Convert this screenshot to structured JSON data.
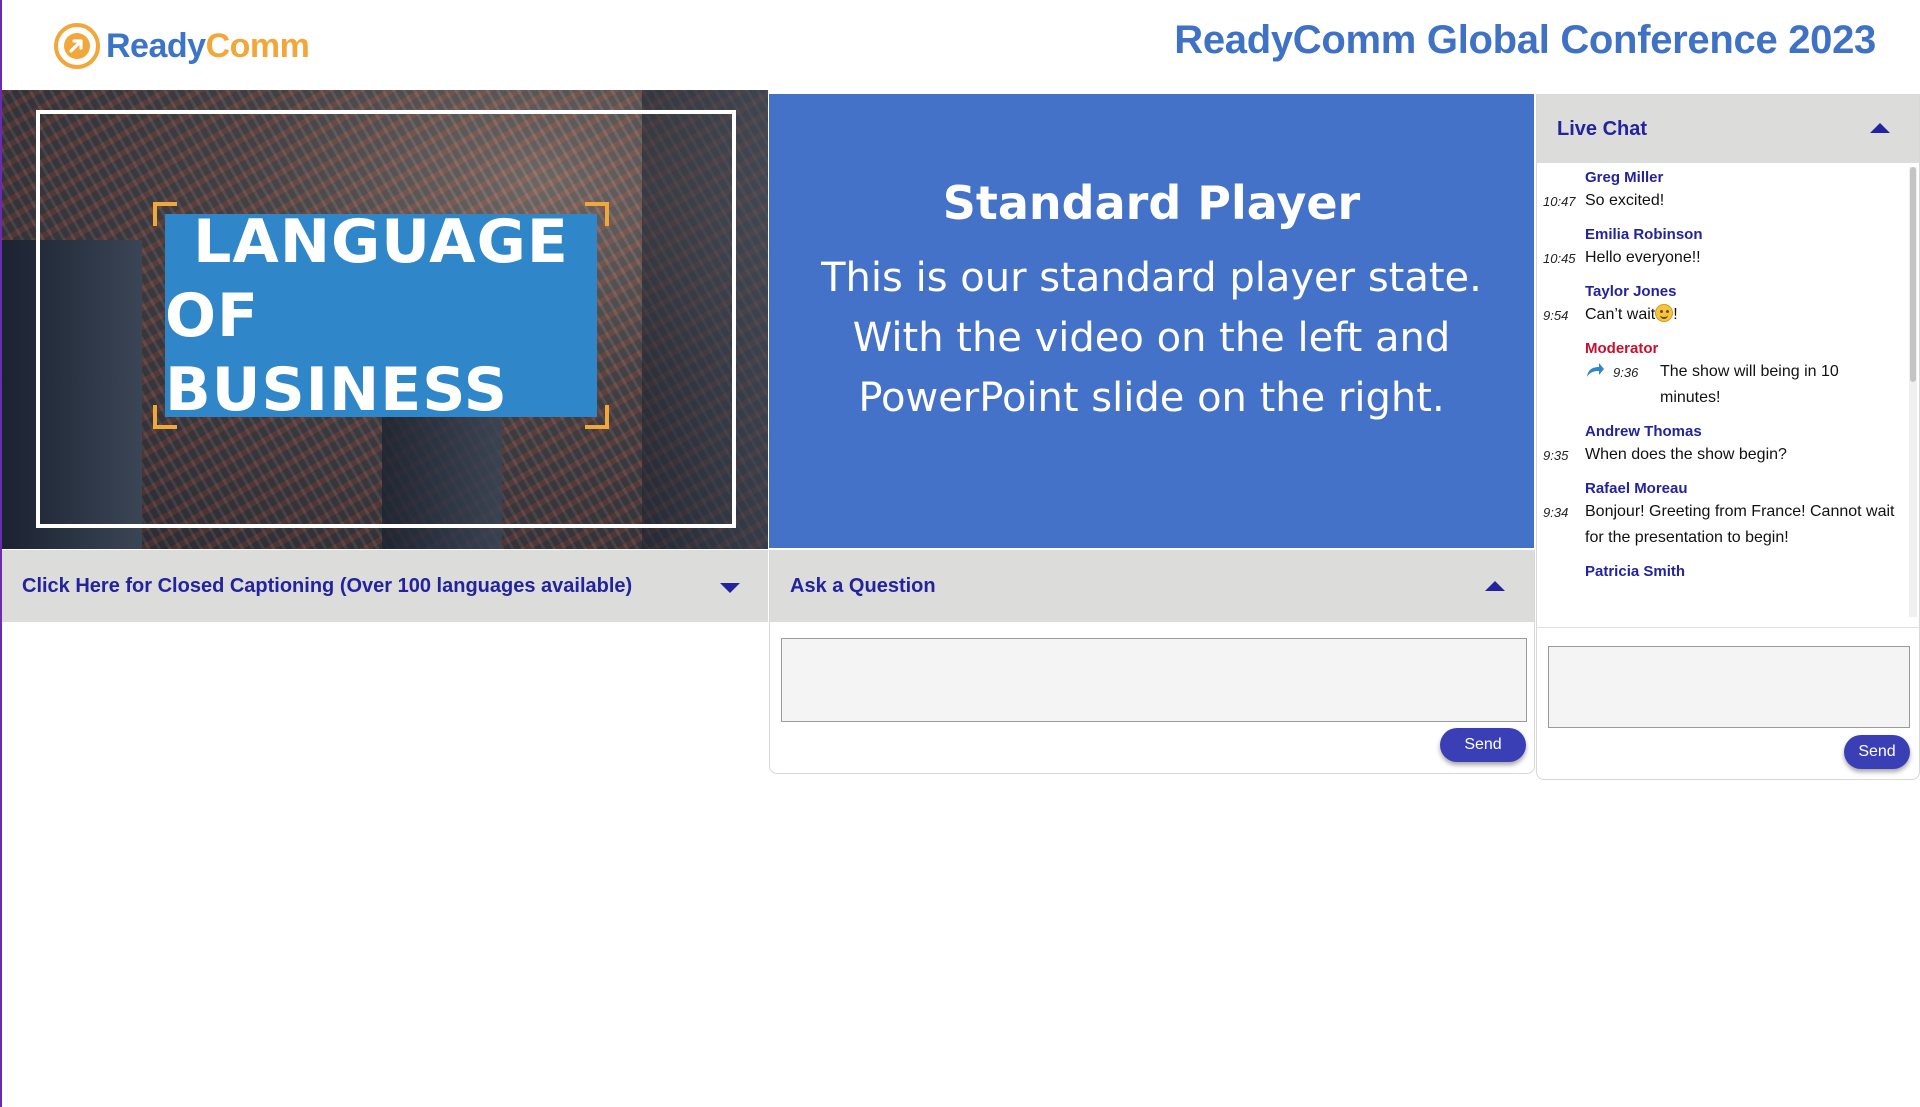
{
  "header": {
    "logo_part1": "Ready",
    "logo_part2": "Comm",
    "title": "ReadyComm Global Conference 2023"
  },
  "video": {
    "title_line1": "LANGUAGE",
    "title_line2": "OF BUSINESS"
  },
  "slide": {
    "title": "Standard Player",
    "line1": "This is our standard player state.",
    "line2": "With the video on the left and",
    "line3": "PowerPoint slide on the right."
  },
  "captions": {
    "label": "Click Here for Closed Captioning (Over 100 languages available)"
  },
  "question": {
    "label": "Ask a Question",
    "input_value": "",
    "send_label": "Send"
  },
  "chat": {
    "title": "Live Chat",
    "messages": [
      {
        "name": "Greg Miller",
        "time": "10:47",
        "text": "So excited!"
      },
      {
        "name": "Emilia Robinson",
        "time": "10:45",
        "text": "Hello everyone!!"
      },
      {
        "name": "Taylor Jones",
        "time": "9:54",
        "text_before": "Can’t wait",
        "text_after": "!",
        "emoji": "smiley-emoji"
      },
      {
        "name": "Moderator",
        "time": "9:36",
        "text": "The show will being in 10 minutes!",
        "role": "moderator",
        "icon": "reply-icon"
      },
      {
        "name": "Andrew Thomas",
        "time": "9:35",
        "text": "When does the show begin?"
      },
      {
        "name": "Rafael Moreau",
        "time": "9:34",
        "text": "Bonjour! Greeting from France! Cannot wait for the presentation to begin!"
      },
      {
        "name": "Patricia Smith"
      }
    ],
    "input_value": "",
    "send_label": "Send"
  },
  "colors": {
    "brand_blue": "#3f72c4",
    "brand_orange": "#f2a73b",
    "slide_blue": "#4472c8",
    "label_navy": "#23239e",
    "moderator_red": "#c8102e",
    "send_button": "#3b3fb5"
  }
}
